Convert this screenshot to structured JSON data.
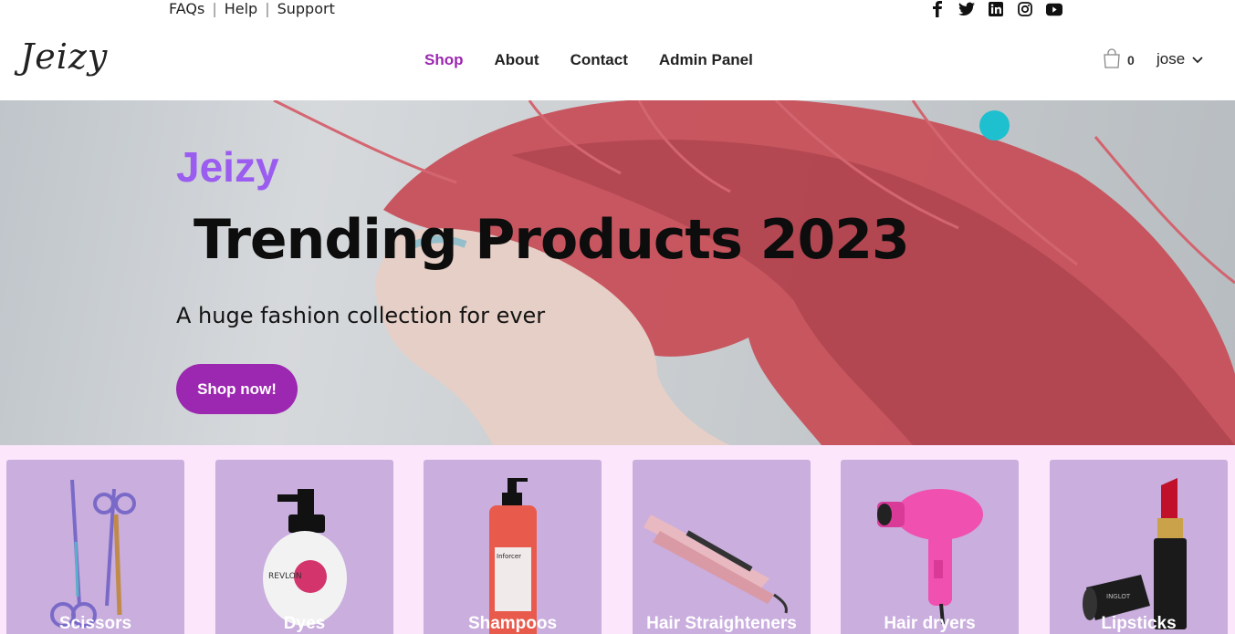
{
  "topbar": {
    "links": [
      "FAQs",
      "Help",
      "Support"
    ],
    "separator": "|",
    "social_icons": [
      "facebook-icon",
      "twitter-icon",
      "linkedin-icon",
      "instagram-icon",
      "youtube-icon"
    ]
  },
  "header": {
    "logo": "Jeizy",
    "nav": [
      {
        "label": "Shop",
        "active": true
      },
      {
        "label": "About",
        "active": false
      },
      {
        "label": "Contact",
        "active": false
      },
      {
        "label": "Admin Panel",
        "active": false
      }
    ],
    "cart_count": "0",
    "user_name": "jose"
  },
  "hero": {
    "brand": "Jeizy",
    "title": "Trending Products 2023",
    "subtitle": "A huge fashion collection for ever",
    "button": "Shop now!"
  },
  "categories": [
    {
      "label": "Scissors",
      "icon": "scissors-image"
    },
    {
      "label": "Dyes",
      "icon": "dye-bottle-image"
    },
    {
      "label": "Shampoos",
      "icon": "shampoo-bottle-image"
    },
    {
      "label": "Hair Straighteners",
      "icon": "hair-straightener-image"
    },
    {
      "label": "Hair dryers",
      "icon": "hair-dryer-image"
    },
    {
      "label": "Lipsticks",
      "icon": "lipstick-image"
    }
  ],
  "colors": {
    "accent": "#9c27b0",
    "brand": "#9b5cf0",
    "category_bg": "#fbe6fc",
    "card_bg": "#c9aede",
    "dot": "#1ec0cf"
  }
}
